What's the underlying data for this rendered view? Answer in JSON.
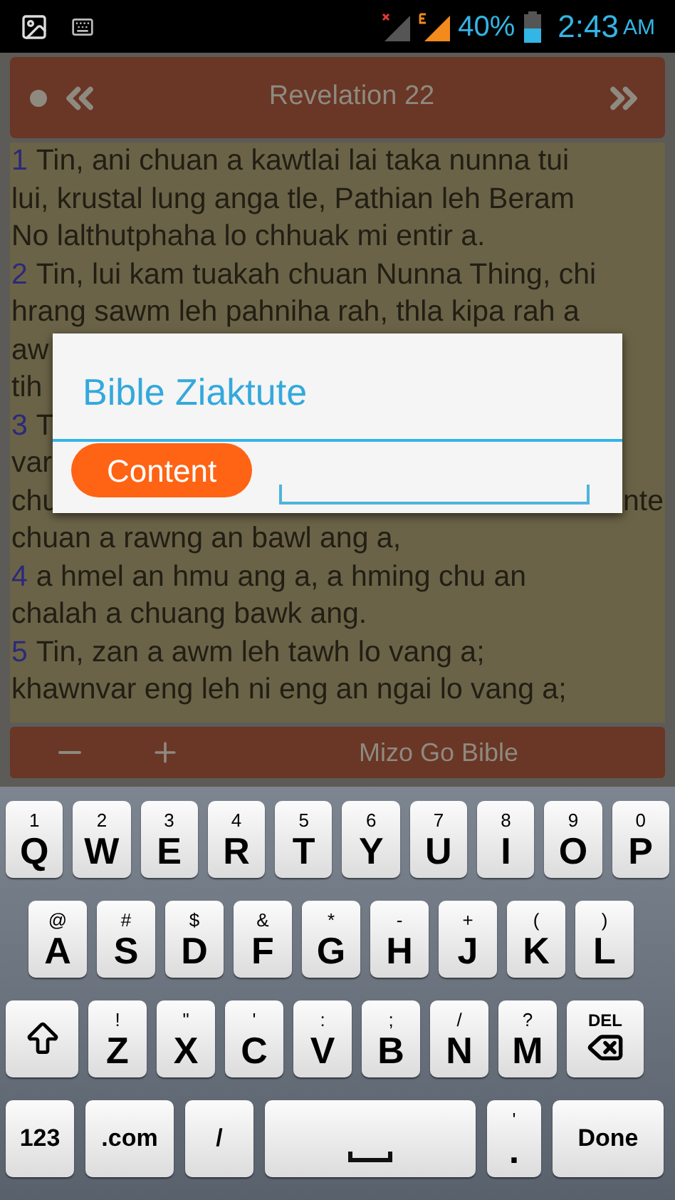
{
  "status_bar": {
    "battery": "40%",
    "time": "2:43",
    "meridiem": "AM"
  },
  "header": {
    "title": "Revelation 22"
  },
  "reading": {
    "lines": [
      {
        "kind": "verse",
        "number": "1",
        "text": "Tin, ani chuan a kawtlai lai taka nunna tui"
      },
      {
        "kind": "line",
        "text": "lui, krustal lung anga tle, Pathian leh Beram"
      },
      {
        "kind": "line",
        "text": "No lalthutphaha lo chhuak mi entir a."
      },
      {
        "kind": "verse",
        "number": "2",
        "text": "Tin, lui kam tuakah chuan Nunna Thing, chi"
      },
      {
        "kind": "line",
        "text": "hrang sawm leh pahniha rah, thla kipa rah a"
      },
      {
        "kind": "partial",
        "left": "aw"
      },
      {
        "kind": "partial",
        "left": "tih"
      },
      {
        "kind": "partial",
        "number": "3",
        "left": "T"
      },
      {
        "kind": "partial",
        "left": "var"
      },
      {
        "kind": "partial",
        "left": "chu",
        "right": "nte"
      },
      {
        "kind": "line",
        "text": "chuan a rawng an bawl ang a,"
      },
      {
        "kind": "verse",
        "number": "4",
        "text": "a hmel an hmu ang a, a hming chu an"
      },
      {
        "kind": "line",
        "text": "chalah a chuang bawk ang."
      },
      {
        "kind": "verse",
        "number": "5",
        "text": "Tin, zan a awm leh tawh lo vang a;"
      },
      {
        "kind": "line",
        "text": "khawnvar eng leh ni eng an ngai lo vang a;"
      }
    ]
  },
  "bottom_bar": {
    "title": "Mizo Go Bible"
  },
  "dialog": {
    "title": "Bible Ziaktute",
    "button": "Content"
  },
  "keyboard": {
    "top_letter_row": [
      {
        "kind": "key",
        "main": "Q",
        "alt": "1"
      },
      {
        "kind": "key",
        "main": "W",
        "alt": "2"
      },
      {
        "kind": "key",
        "main": "E",
        "alt": "3"
      },
      {
        "kind": "key",
        "main": "R",
        "alt": "4"
      },
      {
        "kind": "key",
        "main": "T",
        "alt": "5"
      },
      {
        "kind": "key",
        "main": "Y",
        "alt": "6"
      },
      {
        "kind": "key",
        "main": "U",
        "alt": "7"
      },
      {
        "kind": "key",
        "main": "I",
        "alt": "8"
      },
      {
        "kind": "key",
        "main": "O",
        "alt": "9"
      },
      {
        "kind": "key",
        "main": "P",
        "alt": "0"
      }
    ],
    "middle_letter_row": [
      {
        "kind": "key",
        "main": "A",
        "alt": "@"
      },
      {
        "kind": "key",
        "main": "S",
        "alt": "#"
      },
      {
        "kind": "key",
        "main": "D",
        "alt": "$"
      },
      {
        "kind": "key",
        "main": "F",
        "alt": "&"
      },
      {
        "kind": "key",
        "main": "G",
        "alt": "*"
      },
      {
        "kind": "key",
        "main": "H",
        "alt": "-"
      },
      {
        "kind": "key",
        "main": "J",
        "alt": "+"
      },
      {
        "kind": "key",
        "main": "K",
        "alt": "("
      },
      {
        "kind": "key",
        "main": "L",
        "alt": ")"
      }
    ],
    "bottom_letter_row": [
      {
        "kind": "shift"
      },
      {
        "kind": "key",
        "main": "Z",
        "alt": "!"
      },
      {
        "kind": "key",
        "main": "X",
        "alt": "\""
      },
      {
        "kind": "key",
        "main": "C",
        "alt": "'"
      },
      {
        "kind": "key",
        "main": "V",
        "alt": ":"
      },
      {
        "kind": "key",
        "main": "B",
        "alt": ";"
      },
      {
        "kind": "key",
        "main": "N",
        "alt": "/"
      },
      {
        "kind": "key",
        "main": "M",
        "alt": "?"
      },
      {
        "kind": "delete",
        "label": "DEL"
      }
    ],
    "function_row": [
      {
        "kind": "label",
        "main": "123"
      },
      {
        "kind": "label",
        "main": ".com"
      },
      {
        "kind": "label",
        "main": "/"
      },
      {
        "kind": "space"
      },
      {
        "kind": "key",
        "main": ".",
        "alt": "'"
      },
      {
        "kind": "label",
        "main": "Done"
      }
    ]
  }
}
